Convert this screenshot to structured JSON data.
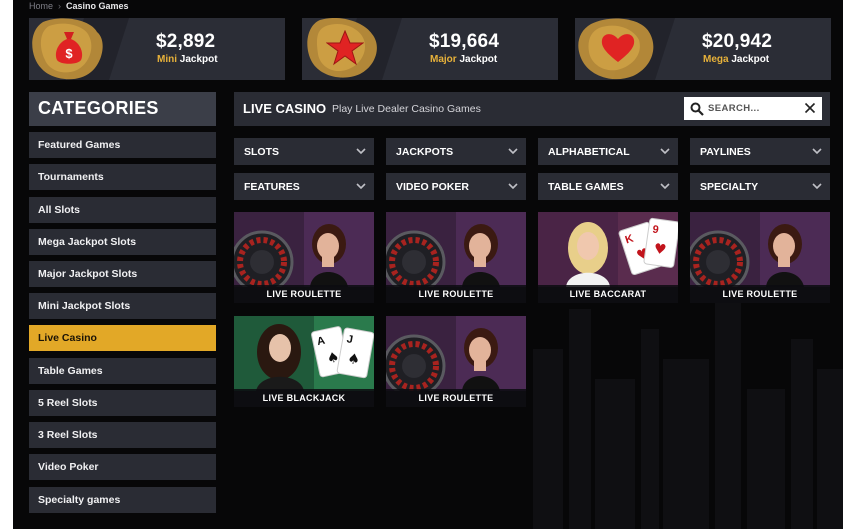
{
  "breadcrumb": {
    "home": "Home",
    "current": "Casino Games"
  },
  "jackpots": [
    {
      "amount": "$2,892",
      "tier": "Mini",
      "suffix": "Jackpot",
      "icon": "money-bag-icon"
    },
    {
      "amount": "$19,664",
      "tier": "Major",
      "suffix": "Jackpot",
      "icon": "star-icon"
    },
    {
      "amount": "$20,942",
      "tier": "Mega",
      "suffix": "Jackpot",
      "icon": "heart-icon"
    }
  ],
  "sidebar": {
    "title": "CATEGORIES",
    "items": [
      {
        "label": "Featured Games"
      },
      {
        "label": "Tournaments"
      },
      {
        "label": "All Slots"
      },
      {
        "label": "Mega Jackpot Slots"
      },
      {
        "label": "Major Jackpot Slots"
      },
      {
        "label": "Mini Jackpot Slots"
      },
      {
        "label": "Live Casino",
        "active": true
      },
      {
        "label": "Table Games"
      },
      {
        "label": "5 Reel Slots"
      },
      {
        "label": "3 Reel Slots"
      },
      {
        "label": "Video Poker"
      },
      {
        "label": "Specialty games"
      }
    ]
  },
  "main": {
    "title": "LIVE CASINO",
    "subtitle": "Play Live Dealer Casino Games",
    "search": {
      "placeholder": "SEARCH..."
    },
    "filters": [
      "SLOTS",
      "JACKPOTS",
      "ALPHABETICAL",
      "PAYLINES",
      "FEATURES",
      "VIDEO POKER",
      "TABLE GAMES",
      "SPECIALTY"
    ],
    "games": [
      {
        "name": "LIVE ROULETTE",
        "kind": "roulette"
      },
      {
        "name": "LIVE ROULETTE",
        "kind": "roulette"
      },
      {
        "name": "LIVE BACCARAT",
        "kind": "baccarat"
      },
      {
        "name": "LIVE ROULETTE",
        "kind": "roulette"
      },
      {
        "name": "LIVE BLACKJACK",
        "kind": "blackjack"
      },
      {
        "name": "LIVE ROULETTE",
        "kind": "roulette"
      }
    ]
  },
  "colors": {
    "accent": "#e2a827",
    "panel": "#2a2c34",
    "background": "#070708",
    "jackpot_tier": "#e8b23a"
  }
}
